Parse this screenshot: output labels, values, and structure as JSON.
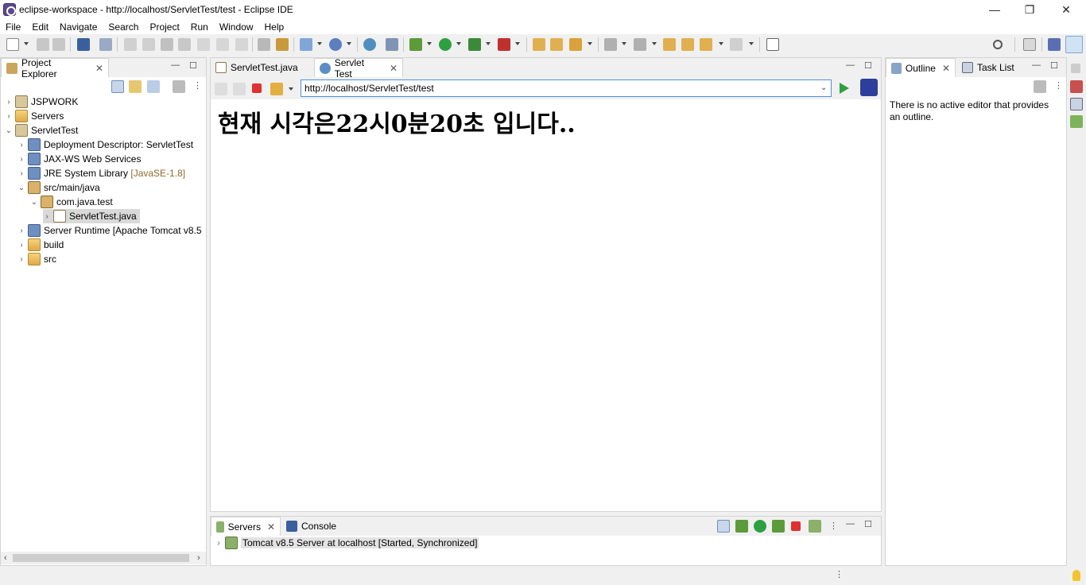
{
  "window": {
    "title": "eclipse-workspace - http://localhost/ServletTest/test - Eclipse IDE",
    "minimize": "—",
    "restore": "❐",
    "close": "✕"
  },
  "menu": [
    {
      "label": "File"
    },
    {
      "label": "Edit"
    },
    {
      "label": "Navigate"
    },
    {
      "label": "Search"
    },
    {
      "label": "Project"
    },
    {
      "label": "Run"
    },
    {
      "label": "Window"
    },
    {
      "label": "Help"
    }
  ],
  "project_explorer": {
    "tab_label": "Project Explorer",
    "close_glyph": "✕",
    "tree": [
      {
        "label": "JSPWORK",
        "suffix": ""
      },
      {
        "label": "Servers",
        "suffix": ""
      },
      {
        "label": "ServletTest",
        "suffix": ""
      },
      {
        "label": "Deployment Descriptor: ServletTest",
        "suffix": ""
      },
      {
        "label": "JAX-WS Web Services",
        "suffix": ""
      },
      {
        "label": "JRE System Library",
        "suffix": "[JavaSE-1.8]"
      },
      {
        "label": "src/main/java",
        "suffix": ""
      },
      {
        "label": "com.java.test",
        "suffix": ""
      },
      {
        "label": "ServletTest.java",
        "suffix": ""
      },
      {
        "label": "Server Runtime [Apache Tomcat v8.5",
        "suffix": ""
      },
      {
        "label": "build",
        "suffix": ""
      },
      {
        "label": "src",
        "suffix": ""
      }
    ]
  },
  "editor": {
    "tabs": [
      {
        "label": "ServletTest.java"
      },
      {
        "label": "Servlet Test"
      }
    ],
    "close_glyph": "✕",
    "url": "http://localhost/ServletTest/test",
    "page_heading": "현재 시각은22시0분20초 입니다.."
  },
  "outline": {
    "tabs": [
      {
        "label": "Outline"
      },
      {
        "label": "Task List"
      }
    ],
    "close_glyph": "✕",
    "message": "There is no active editor that provides an outline."
  },
  "bottom_panel": {
    "tabs": [
      {
        "label": "Servers"
      },
      {
        "label": "Console"
      }
    ],
    "close_glyph": "✕",
    "server_entry": "Tomcat v8.5 Server at localhost  [Started, Synchronized]"
  },
  "colors": {
    "accent": "#4a90d9",
    "run_green": "#2ea043",
    "stop_red": "#e03030"
  },
  "icons": {
    "search": "search-icon",
    "chevron_right": "›",
    "chevron_down": "⌄"
  }
}
